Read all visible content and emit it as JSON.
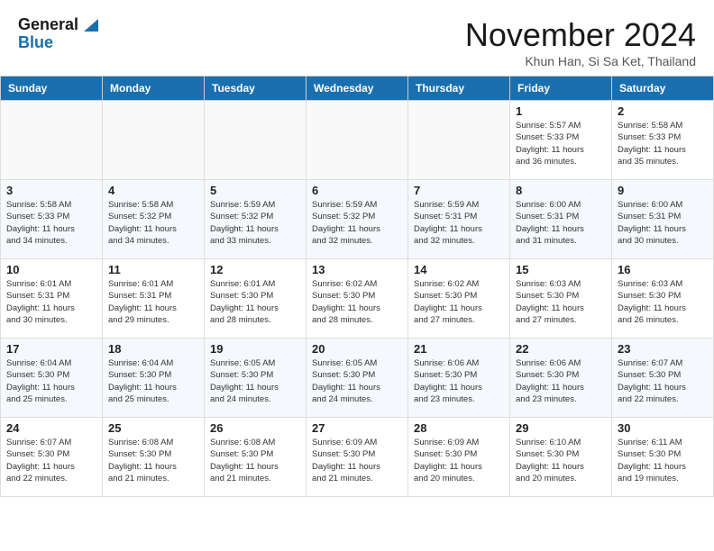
{
  "header": {
    "logo_line1": "General",
    "logo_line2": "Blue",
    "month": "November 2024",
    "location": "Khun Han, Si Sa Ket, Thailand"
  },
  "weekdays": [
    "Sunday",
    "Monday",
    "Tuesday",
    "Wednesday",
    "Thursday",
    "Friday",
    "Saturday"
  ],
  "weeks": [
    [
      {
        "day": "",
        "info": ""
      },
      {
        "day": "",
        "info": ""
      },
      {
        "day": "",
        "info": ""
      },
      {
        "day": "",
        "info": ""
      },
      {
        "day": "",
        "info": ""
      },
      {
        "day": "1",
        "info": "Sunrise: 5:57 AM\nSunset: 5:33 PM\nDaylight: 11 hours\nand 36 minutes."
      },
      {
        "day": "2",
        "info": "Sunrise: 5:58 AM\nSunset: 5:33 PM\nDaylight: 11 hours\nand 35 minutes."
      }
    ],
    [
      {
        "day": "3",
        "info": "Sunrise: 5:58 AM\nSunset: 5:33 PM\nDaylight: 11 hours\nand 34 minutes."
      },
      {
        "day": "4",
        "info": "Sunrise: 5:58 AM\nSunset: 5:32 PM\nDaylight: 11 hours\nand 34 minutes."
      },
      {
        "day": "5",
        "info": "Sunrise: 5:59 AM\nSunset: 5:32 PM\nDaylight: 11 hours\nand 33 minutes."
      },
      {
        "day": "6",
        "info": "Sunrise: 5:59 AM\nSunset: 5:32 PM\nDaylight: 11 hours\nand 32 minutes."
      },
      {
        "day": "7",
        "info": "Sunrise: 5:59 AM\nSunset: 5:31 PM\nDaylight: 11 hours\nand 32 minutes."
      },
      {
        "day": "8",
        "info": "Sunrise: 6:00 AM\nSunset: 5:31 PM\nDaylight: 11 hours\nand 31 minutes."
      },
      {
        "day": "9",
        "info": "Sunrise: 6:00 AM\nSunset: 5:31 PM\nDaylight: 11 hours\nand 30 minutes."
      }
    ],
    [
      {
        "day": "10",
        "info": "Sunrise: 6:01 AM\nSunset: 5:31 PM\nDaylight: 11 hours\nand 30 minutes."
      },
      {
        "day": "11",
        "info": "Sunrise: 6:01 AM\nSunset: 5:31 PM\nDaylight: 11 hours\nand 29 minutes."
      },
      {
        "day": "12",
        "info": "Sunrise: 6:01 AM\nSunset: 5:30 PM\nDaylight: 11 hours\nand 28 minutes."
      },
      {
        "day": "13",
        "info": "Sunrise: 6:02 AM\nSunset: 5:30 PM\nDaylight: 11 hours\nand 28 minutes."
      },
      {
        "day": "14",
        "info": "Sunrise: 6:02 AM\nSunset: 5:30 PM\nDaylight: 11 hours\nand 27 minutes."
      },
      {
        "day": "15",
        "info": "Sunrise: 6:03 AM\nSunset: 5:30 PM\nDaylight: 11 hours\nand 27 minutes."
      },
      {
        "day": "16",
        "info": "Sunrise: 6:03 AM\nSunset: 5:30 PM\nDaylight: 11 hours\nand 26 minutes."
      }
    ],
    [
      {
        "day": "17",
        "info": "Sunrise: 6:04 AM\nSunset: 5:30 PM\nDaylight: 11 hours\nand 25 minutes."
      },
      {
        "day": "18",
        "info": "Sunrise: 6:04 AM\nSunset: 5:30 PM\nDaylight: 11 hours\nand 25 minutes."
      },
      {
        "day": "19",
        "info": "Sunrise: 6:05 AM\nSunset: 5:30 PM\nDaylight: 11 hours\nand 24 minutes."
      },
      {
        "day": "20",
        "info": "Sunrise: 6:05 AM\nSunset: 5:30 PM\nDaylight: 11 hours\nand 24 minutes."
      },
      {
        "day": "21",
        "info": "Sunrise: 6:06 AM\nSunset: 5:30 PM\nDaylight: 11 hours\nand 23 minutes."
      },
      {
        "day": "22",
        "info": "Sunrise: 6:06 AM\nSunset: 5:30 PM\nDaylight: 11 hours\nand 23 minutes."
      },
      {
        "day": "23",
        "info": "Sunrise: 6:07 AM\nSunset: 5:30 PM\nDaylight: 11 hours\nand 22 minutes."
      }
    ],
    [
      {
        "day": "24",
        "info": "Sunrise: 6:07 AM\nSunset: 5:30 PM\nDaylight: 11 hours\nand 22 minutes."
      },
      {
        "day": "25",
        "info": "Sunrise: 6:08 AM\nSunset: 5:30 PM\nDaylight: 11 hours\nand 21 minutes."
      },
      {
        "day": "26",
        "info": "Sunrise: 6:08 AM\nSunset: 5:30 PM\nDaylight: 11 hours\nand 21 minutes."
      },
      {
        "day": "27",
        "info": "Sunrise: 6:09 AM\nSunset: 5:30 PM\nDaylight: 11 hours\nand 21 minutes."
      },
      {
        "day": "28",
        "info": "Sunrise: 6:09 AM\nSunset: 5:30 PM\nDaylight: 11 hours\nand 20 minutes."
      },
      {
        "day": "29",
        "info": "Sunrise: 6:10 AM\nSunset: 5:30 PM\nDaylight: 11 hours\nand 20 minutes."
      },
      {
        "day": "30",
        "info": "Sunrise: 6:11 AM\nSunset: 5:30 PM\nDaylight: 11 hours\nand 19 minutes."
      }
    ]
  ]
}
